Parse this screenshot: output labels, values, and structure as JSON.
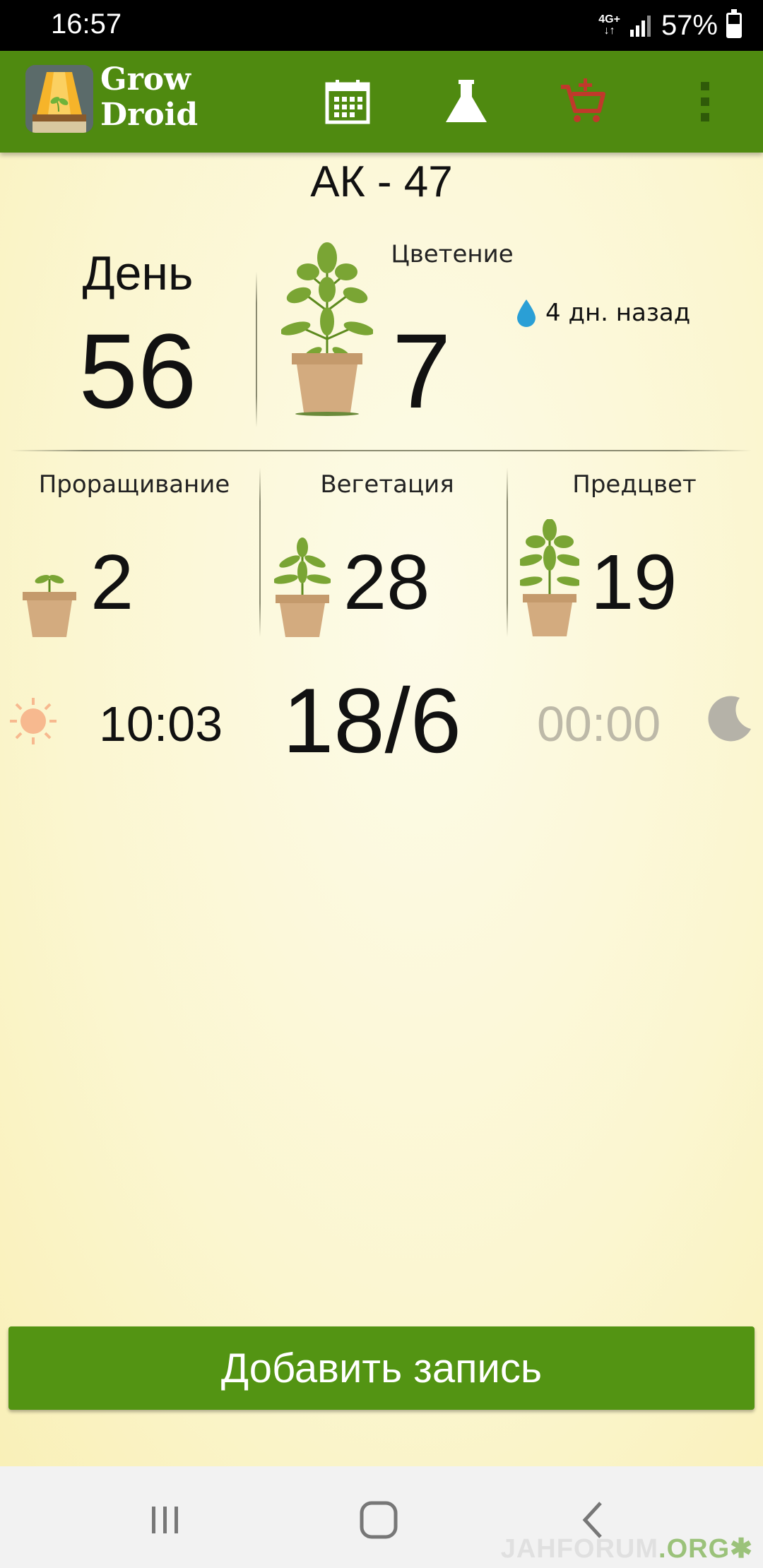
{
  "status_bar": {
    "time": "16:57",
    "network": "4G+",
    "battery": "57%",
    "battery_level": 0.57
  },
  "app_bar": {
    "name_line1": "Grow",
    "name_line2": "Droid",
    "icons": [
      "calendar-icon",
      "flask-icon",
      "cart-add-icon",
      "more-vert-icon"
    ],
    "cart_color": "#c0392b"
  },
  "plant": {
    "strain": "АК - 47",
    "day_label": "День",
    "day_value": "56",
    "stage_label": "Цветение",
    "stage_value": "7",
    "watered": "4 дн. назад"
  },
  "phases": [
    {
      "label": "Проращивание",
      "value": "2"
    },
    {
      "label": "Вегетация",
      "value": "28"
    },
    {
      "label": "Предцвет",
      "value": "19"
    }
  ],
  "light": {
    "on_time": "10:03",
    "schedule": "18/6",
    "off_time": "00:00"
  },
  "add_button": {
    "label": "Добавить запись"
  },
  "watermark": {
    "main": "JAHFORUM",
    "suffix": ".ORG"
  },
  "colors": {
    "app_bar": "#4f8a10",
    "button": "#539413",
    "background": "#fbf6d0",
    "water": "#2a9fd6"
  }
}
